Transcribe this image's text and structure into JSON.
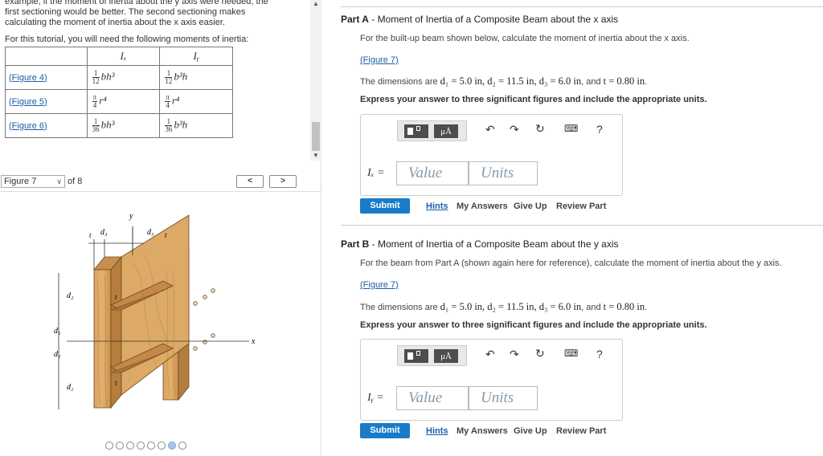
{
  "left": {
    "intro_lines": [
      "example, if the moment of inertia about the y axis were needed, the",
      "first sectioning would be better. The second sectioning makes",
      "calculating the moment of inertia about the x axis easier."
    ],
    "intro_bottom": "For this tutorial, you will need the following moments of inertia:",
    "table": {
      "headers": [
        "",
        "Iₓ",
        "Iᵧ"
      ],
      "rows": [
        {
          "link": "(Figure 4)",
          "ix_coef": [
            "1",
            "12"
          ],
          "ix_expr": "bh³",
          "iy_coef": [
            "1",
            "12"
          ],
          "iy_expr": "b³h"
        },
        {
          "link": "(Figure 5)",
          "ix_coef": [
            "π",
            "4"
          ],
          "ix_expr": "r⁴",
          "iy_coef": [
            "π",
            "4"
          ],
          "iy_expr": "r⁴"
        },
        {
          "link": "(Figure 6)",
          "ix_coef": [
            "1",
            "36"
          ],
          "ix_expr": "bh³",
          "iy_coef": [
            "1",
            "36"
          ],
          "iy_expr": "b³h"
        }
      ]
    },
    "figure_select": "Figure 7",
    "figure_of": "of 8",
    "prev_label": "<",
    "next_label": ">",
    "figure_labels": {
      "y": "y",
      "x": "x",
      "t": "t",
      "d1": "d₁",
      "d2": "d₂",
      "d3": "d₃"
    },
    "pager_count": 8,
    "pager_active": 6
  },
  "parts": [
    {
      "part_label": "Part A",
      "title": "Moment of Inertia of a Composite Beam about the x axis",
      "instruction": "For the built-up beam shown below, calculate the moment of inertia about the x axis.",
      "figure_link": "(Figure 7)",
      "dims_prefix": "The dimensions are ",
      "dims_math": "d₁ = 5.0 in, d₂ = 11.5 in, d₃ = 6.0 in",
      "dims_and": ", and ",
      "dims_t": "t = 0.80 in",
      "dims_end": ".",
      "express": "Express your answer to three significant figures and include the appropriate units.",
      "eq_label": "Iₓ =",
      "value_placeholder": "Value",
      "units_placeholder": "Units",
      "submit": "Submit",
      "hints": "Hints",
      "my_answers": "My Answers",
      "give_up": "Give Up",
      "review": "Review Part"
    },
    {
      "part_label": "Part B",
      "title": "Moment of Inertia of a Composite Beam about the y axis",
      "instruction": "For the beam from Part A (shown again here for reference), calculate the moment of inertia about the y axis.",
      "figure_link": "(Figure 7)",
      "dims_prefix": "The dimensions are ",
      "dims_math": "d₁ = 5.0 in, d₂ = 11.5 in, d₃ = 6.0 in",
      "dims_and": ", and ",
      "dims_t": "t = 0.80 in",
      "dims_end": ".",
      "express": "Express your answer to three significant figures and include the appropriate units.",
      "eq_label": "Iᵧ =",
      "value_placeholder": "Value",
      "units_placeholder": "Units",
      "submit": "Submit",
      "hints": "Hints",
      "my_answers": "My Answers",
      "give_up": "Give Up",
      "review": "Review Part"
    }
  ],
  "toolbar": {
    "templates_icon": "templates-icon",
    "units_icon_label": "μÅ",
    "undo_icon": "undo-icon",
    "redo_icon": "redo-icon",
    "reset_icon": "reset-icon",
    "keyboard_icon": "keyboard-icon",
    "help_label": "?"
  }
}
